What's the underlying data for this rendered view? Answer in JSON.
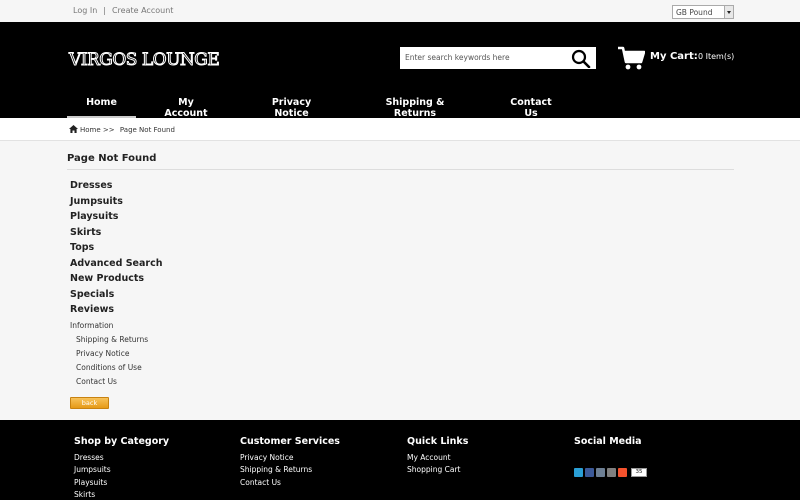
{
  "top": {
    "login": "Log In",
    "sep": "|",
    "create_account": "Create Account",
    "currency": "GB Pound"
  },
  "header": {
    "logo": "VIRGOS LOUNGE",
    "search_placeholder": "Enter search keywords here",
    "cart_label": "My Cart:",
    "cart_count": "0 Item(s)"
  },
  "nav": [
    {
      "label": "Home",
      "active": true
    },
    {
      "label": "My Account"
    },
    {
      "label": "Privacy Notice"
    },
    {
      "label": "Shipping & Returns"
    },
    {
      "label": "Contact Us"
    }
  ],
  "breadcrumb": {
    "home": "Home",
    "sep": ">>",
    "current": "Page Not Found"
  },
  "page_title": "Page Not Found",
  "categories": [
    "Dresses",
    "Jumpsuits",
    "Playsuits",
    "Skirts",
    "Tops",
    "Advanced Search",
    "New Products",
    "Specials",
    "Reviews"
  ],
  "information": {
    "heading": "Information",
    "items": [
      "Shipping & Returns",
      "Privacy Notice",
      "Conditions of Use",
      "Contact Us"
    ]
  },
  "back_button": "back",
  "footer": {
    "shop": {
      "heading": "Shop by Category",
      "links": [
        "Dresses",
        "Jumpsuits",
        "Playsuits",
        "Skirts"
      ]
    },
    "customer": {
      "heading": "Customer Services",
      "links": [
        "Privacy Notice",
        "Shipping & Returns",
        "Contact Us"
      ]
    },
    "quick": {
      "heading": "Quick Links",
      "links": [
        "My Account",
        "Shopping Cart"
      ]
    },
    "social": {
      "heading": "Social Media",
      "share_count": "35"
    }
  },
  "colors": {
    "header_bg": "#000000",
    "page_bg": "#f6f6f6",
    "back_button": "#e69a17",
    "twitter": "#2a9fd6",
    "facebook": "#3b5998",
    "print": "#6d7f94",
    "email": "#7f7f7f",
    "addthis": "#f5522d"
  }
}
